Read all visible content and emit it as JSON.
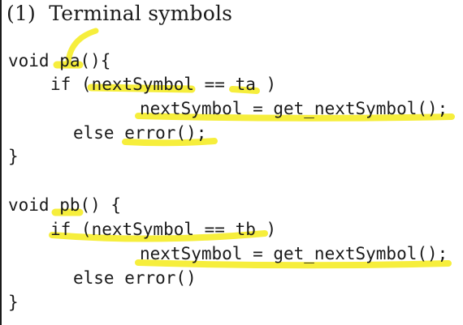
{
  "heading": "(1)  Terminal symbols",
  "code_lines": [
    "void pa(){",
    "if (nextSymbol == ta )",
    "nextSymbol = get_nextSymbol();",
    "else error();",
    "}",
    "void pb() {",
    "if (nextSymbol == tb )",
    "nextSymbol = get_nextSymbol();",
    "else error()",
    "}"
  ],
  "highlight_color": "#f6ee3c"
}
